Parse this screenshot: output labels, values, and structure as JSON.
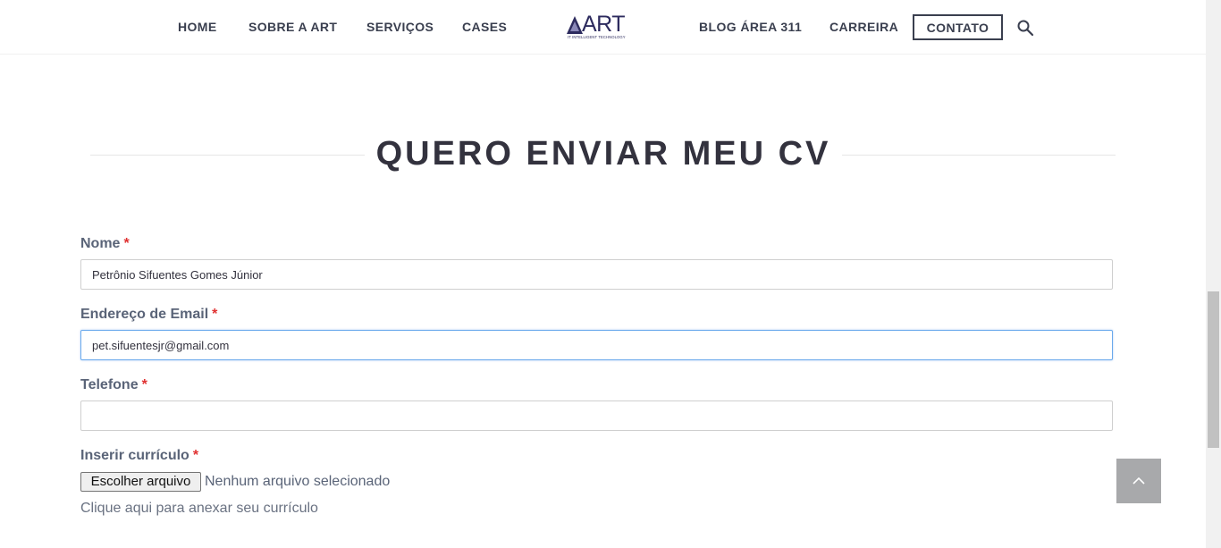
{
  "nav": {
    "home": "HOME",
    "sobre": "SOBRE A ART",
    "servicos": "SERVIÇOS",
    "cases": "CASES",
    "blog": "BLOG ÁREA 311",
    "carreira": "CARREIRA",
    "contato": "CONTATO"
  },
  "logo": {
    "text": "ART",
    "tagline": "IT INTELLIGENT TECHNOLOGY"
  },
  "section": {
    "title": "QUERO ENVIAR MEU CV"
  },
  "form": {
    "nome": {
      "label": "Nome",
      "required": "*",
      "value": "Petrônio Sifuentes Gomes Júnior"
    },
    "email": {
      "label": "Endereço de Email",
      "required": "*",
      "value": "pet.sifuentesjr@gmail.com"
    },
    "telefone": {
      "label": "Telefone",
      "required": "*",
      "value": ""
    },
    "curriculo": {
      "label": "Inserir currículo",
      "required": "*",
      "button": "Escolher arquivo",
      "status": "Nenhum arquivo selecionado",
      "help": "Clique aqui para anexar seu currículo"
    }
  },
  "colors": {
    "accent": "#33323e",
    "required": "#e03131",
    "focus": "#6aa9ec",
    "back_to_top": "#a8a9ab"
  },
  "icons": {
    "search": "search-icon",
    "back_to_top": "chevron-up-icon"
  }
}
